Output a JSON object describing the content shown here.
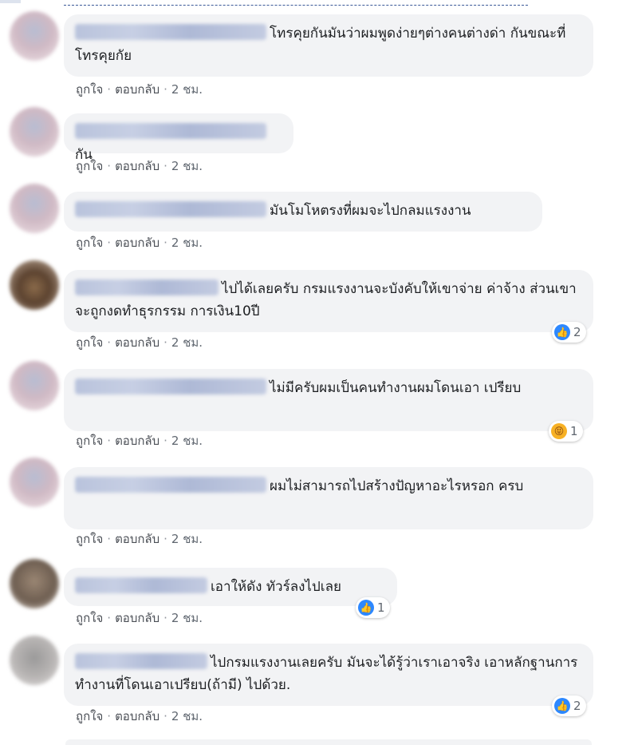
{
  "comments": [
    {
      "text": "โทรคุยกันมันว่าผมพูดง่ายๆต่างคนต่างด่า กันขณะที่โทรคุยกัย",
      "like": "ถูกใจ",
      "reply": "ตอบกลับ",
      "time": "2 ชม.",
      "reaction_count": "",
      "reaction_icon": "",
      "avatar": "pink"
    },
    {
      "text": "กัน",
      "like": "ถูกใจ",
      "reply": "ตอบกลับ",
      "time": "2 ชม.",
      "reaction_count": "",
      "reaction_icon": "",
      "avatar": "pink"
    },
    {
      "text": "มันโมโหตรงที่ผมจะไปกลมแรงงาน",
      "like": "ถูกใจ",
      "reply": "ตอบกลับ",
      "time": "2 ชม.",
      "reaction_count": "",
      "reaction_icon": "",
      "avatar": "pink"
    },
    {
      "text": "ไปได้เลยครับ กรมแรงงานจะบังคับให้เขาจ่าย ค่าจ้าง ส่วนเขาจะถูกงดทำธุรกรรม การเงิน10ปี",
      "like": "ถูกใจ",
      "reply": "ตอบกลับ",
      "time": "2 ชม.",
      "reaction_count": "2",
      "reaction_icon": "like-icon",
      "avatar": "dark"
    },
    {
      "text": "ไม่มีครับผมเป็นคนทำงานผมโดนเอา เปรียบ",
      "like": "ถูกใจ",
      "reply": "ตอบกลับ",
      "time": "2 ชม.",
      "reaction_count": "1",
      "reaction_icon": "haha-icon",
      "avatar": "pink"
    },
    {
      "text": "ผมไม่สามารถไปสร้างปัญหาอะไรหรอก ครบ",
      "like": "ถูกใจ",
      "reply": "ตอบกลับ",
      "time": "2 ชม.",
      "reaction_count": "",
      "reaction_icon": "",
      "avatar": "pink"
    },
    {
      "text": "เอาให้ดัง ทัวร์ลงไปเลย",
      "like": "ถูกใจ",
      "reply": "ตอบกลับ",
      "time": "2 ชม.",
      "reaction_count": "1",
      "reaction_icon": "like-icon",
      "avatar": "brownface"
    },
    {
      "text": "ไปกรมแรงงานเลยครับ มันจะได้รู้ว่าเราเอาจริง เอาหลักฐานการทำงานที่โดนเอาเปรียบ(ถ้ามี) ไปด้วย.",
      "like": "ถูกใจ",
      "reply": "ตอบกลับ",
      "time": "2 ชม.",
      "reaction_count": "2",
      "reaction_icon": "like-icon",
      "avatar": "gray"
    }
  ],
  "separator": "·",
  "colors": {
    "bubble": "#f2f3f5",
    "like_blue": "#2d88ff",
    "meta_text": "#606770"
  }
}
